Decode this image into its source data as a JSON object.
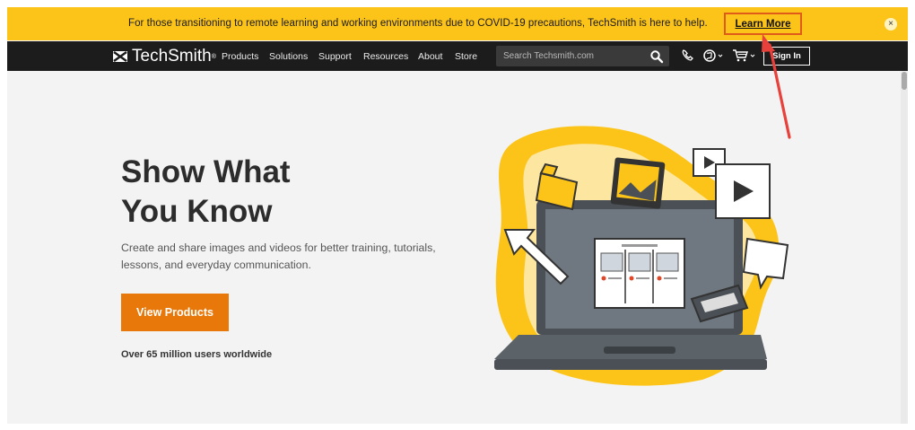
{
  "banner": {
    "message": "For those transitioning to remote learning and working environments due to COVID-19 precautions, TechSmith is here to help.",
    "learn_more": "Learn More",
    "close": "×"
  },
  "nav": {
    "logo": "TechSmith",
    "logo_mark": "®",
    "links": [
      "Products",
      "Solutions",
      "Support",
      "Resources",
      "About",
      "Store"
    ],
    "search_placeholder": "Search Techsmith.com",
    "sign_in": "Sign In"
  },
  "hero": {
    "title_line1": "Show What",
    "title_line2": "You Know",
    "description": "Create and share images and videos for better training, tutorials, lessons, and everyday communication.",
    "cta": "View Products",
    "users": "Over 65 million users worldwide"
  },
  "colors": {
    "banner": "#fcc419",
    "nav": "#1c1c1c",
    "cta": "#e9780a",
    "highlight": "#e05a1a"
  }
}
